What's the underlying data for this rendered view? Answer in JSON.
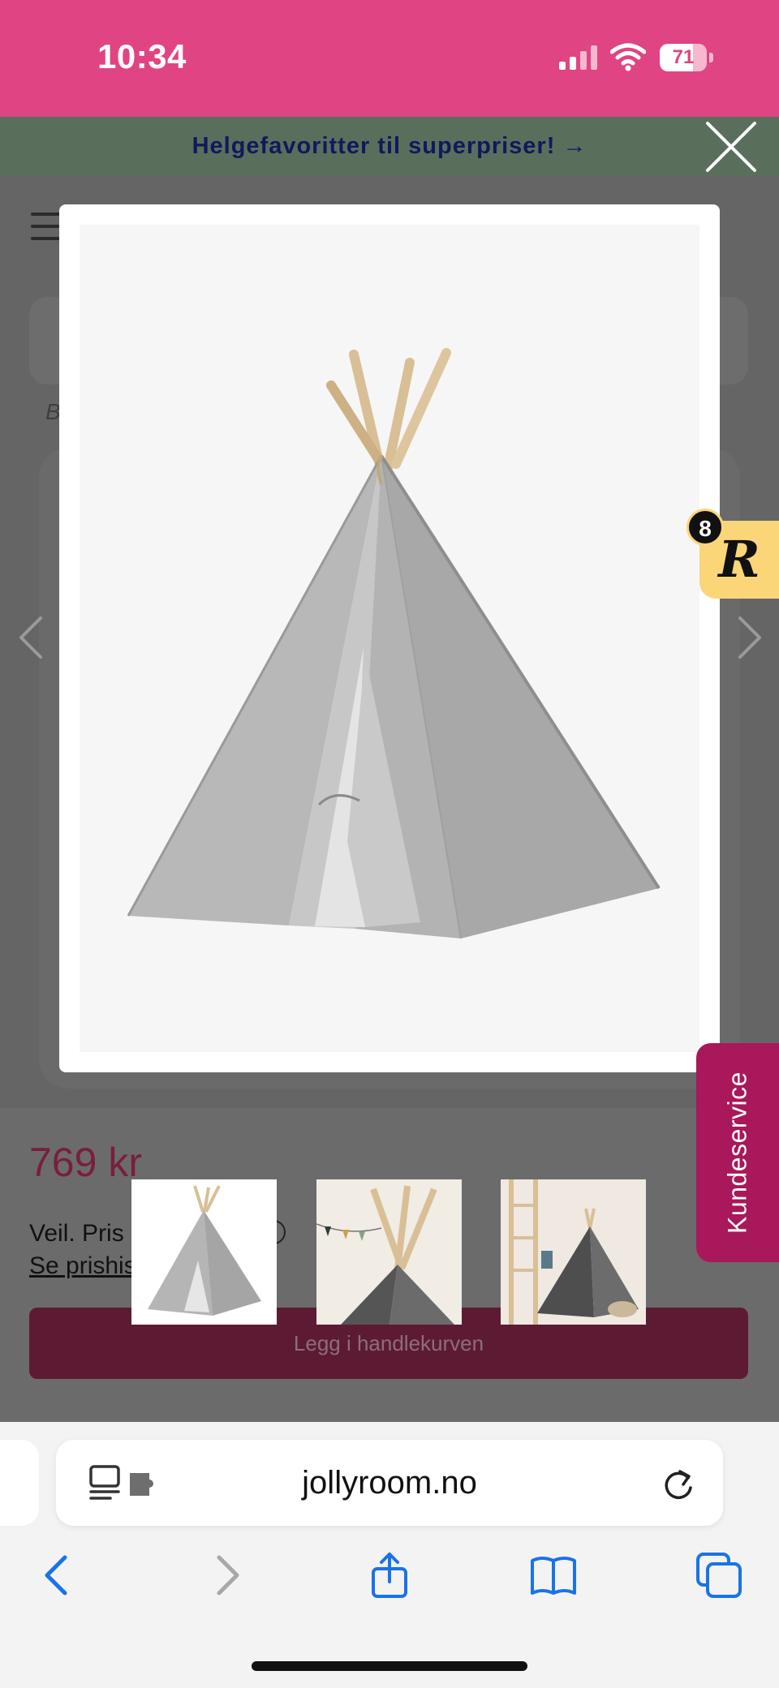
{
  "status_bar": {
    "time": "10:34",
    "battery": "71",
    "battery_level": 0.71,
    "icons": [
      "signal-icon",
      "wifi-icon",
      "battery-icon"
    ]
  },
  "promo": {
    "text": "Helgefavoritter til superpriser! →",
    "close_icon": "close-icon"
  },
  "product": {
    "price": "769 kr",
    "price_note_prefix": "Veil. Pris",
    "price_link_prefix": "Se prishis",
    "cart_button": "Legg i handlekurven",
    "breadcrumb_stub": "B"
  },
  "modal": {
    "image": "teepee-tent-gray",
    "thumbnails": [
      "teepee-gray",
      "teepee-with-bunting",
      "teepee-in-room"
    ]
  },
  "widgets": {
    "review_count": "8",
    "review_logo": "R",
    "customer_service": "Kundeservice"
  },
  "browser": {
    "url": "jollyroom.no",
    "icons": [
      "reader-icon",
      "extension-icon",
      "reload-icon",
      "back-icon",
      "forward-icon",
      "share-icon",
      "bookmarks-icon",
      "tabs-icon"
    ]
  },
  "colors": {
    "status_bar": "#e14482",
    "promo_bg": "#5a6e5c",
    "promo_text": "#0f1a5c",
    "price": "#7a1e3c",
    "cart_button": "#5c1b33",
    "customer_service": "#a8185a",
    "review_tab": "#fbd679",
    "browser_accent": "#1a73e8"
  }
}
